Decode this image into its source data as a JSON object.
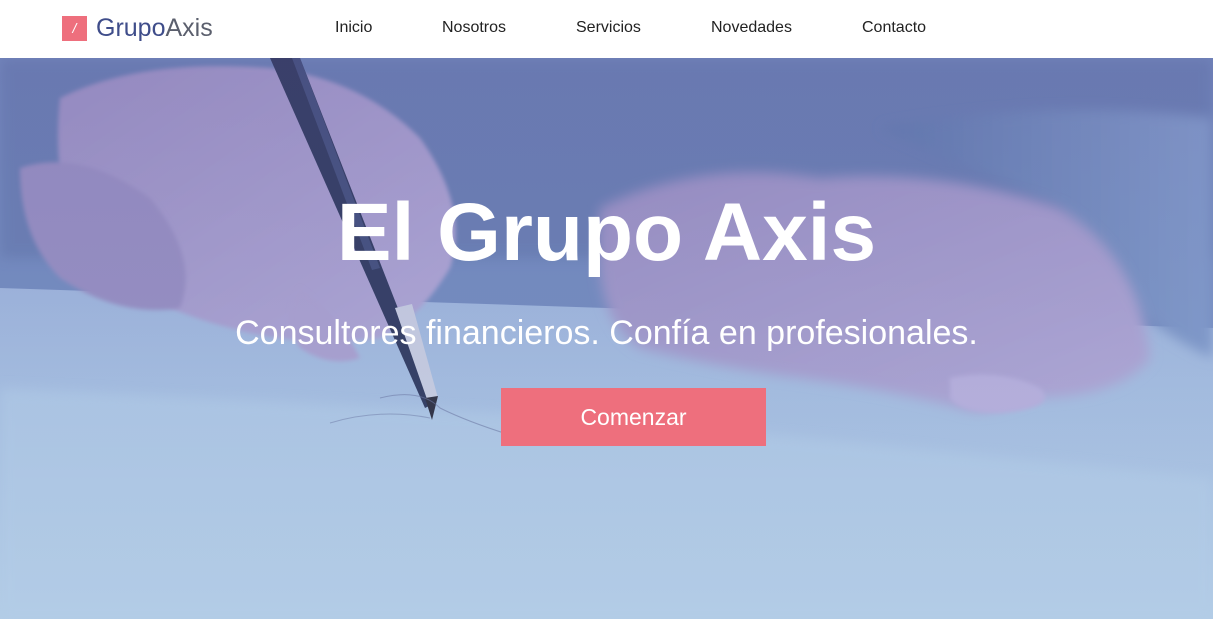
{
  "brand": {
    "logo_mark": "/",
    "name_part1": "Grupo",
    "name_part2": "Axis",
    "accent_color": "#ee6f7d",
    "name_color_primary": "#3f4d8a"
  },
  "nav": {
    "items": [
      {
        "label": "Inicio"
      },
      {
        "label": "Nosotros"
      },
      {
        "label": "Servicios"
      },
      {
        "label": "Novedades"
      },
      {
        "label": "Contacto"
      }
    ]
  },
  "hero": {
    "title": "El Grupo Axis",
    "subtitle": "Consultores financieros. Confía en profesionales.",
    "cta_label": "Comenzar",
    "background_description_icon": "hands-signing-document-photo",
    "overlay_color": "#8ea6cf"
  }
}
